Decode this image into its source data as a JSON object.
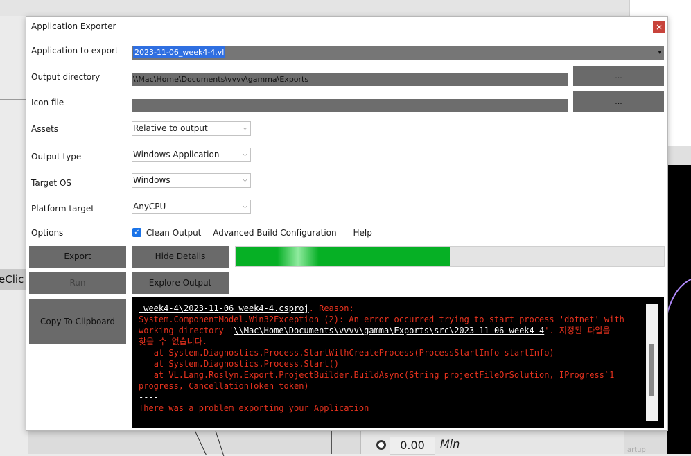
{
  "background": {
    "partial_label": "eClic",
    "number_value": "0.00",
    "min_label": "Min",
    "startup_fragment": "artup"
  },
  "dialog": {
    "title": "Application Exporter",
    "close_glyph": "×"
  },
  "form": {
    "application_label": "Application to export",
    "application_value": "2023-11-06_week4-4.vl",
    "output_dir_label": "Output directory",
    "output_dir_value": "\\\\Mac\\Home\\Documents\\vvvv\\gamma\\Exports",
    "icon_label": "Icon file",
    "icon_value": "",
    "browse_label": "...",
    "assets_label": "Assets",
    "assets_value": "Relative to output",
    "output_type_label": "Output type",
    "output_type_value": "Windows Application",
    "target_os_label": "Target OS",
    "target_os_value": "Windows",
    "platform_label": "Platform target",
    "platform_value": "AnyCPU",
    "options_label": "Options",
    "clean_output_label": "Clean Output",
    "clean_output_checked": true,
    "advanced_label": "Advanced Build Configuration",
    "help_label": "Help"
  },
  "buttons": {
    "export": "Export",
    "hide_details": "Hide Details",
    "run": "Run",
    "explore_output": "Explore Output",
    "copy_clipboard": "Copy To Clipboard"
  },
  "progress": {
    "fraction": 0.5,
    "color": "#06b025"
  },
  "console": {
    "line1_path": "_week4-4\\2023-11-06_week4-4.csproj",
    "line1_rest": ". Reason:",
    "line2": "System.ComponentModel.Win32Exception (2): An error occurred trying to start process 'dotnet' with",
    "line3_pre": "working directory '",
    "line3_path": "\\\\Mac\\Home\\Documents\\vvvv\\gamma\\Exports\\src\\2023-11-06_week4-4",
    "line3_post": "'. 지정된 파일을",
    "line4": "찾을 수 없습니다.",
    "line5": "   at System.Diagnostics.Process.StartWithCreateProcess(ProcessStartInfo startInfo)",
    "line6": "   at System.Diagnostics.Process.Start()",
    "line7": "   at VL.Lang.Roslyn.Export.ProjectBuilder.BuildAsync(String projectFileOrSolution, IProgress`1",
    "line8": "progress, CancellationToken token)",
    "line9": "----",
    "line10": "There was a problem exporting your Application"
  }
}
